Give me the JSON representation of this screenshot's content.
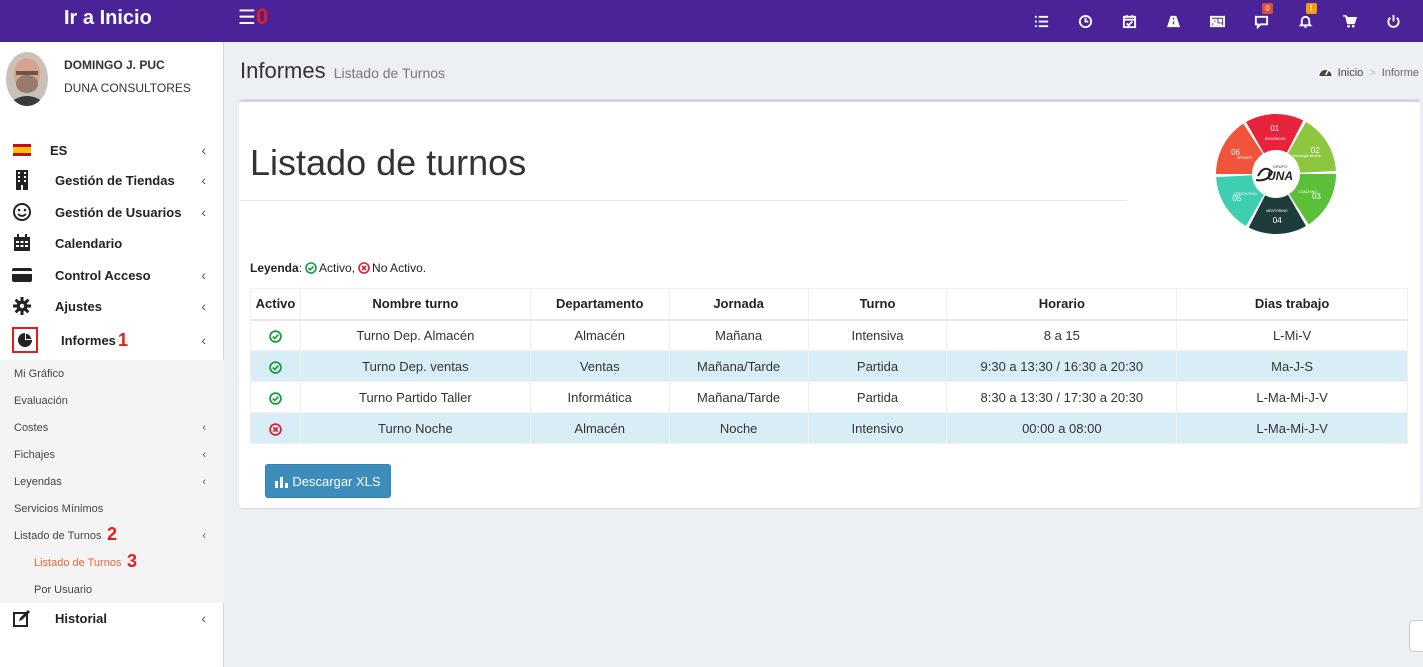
{
  "topbar": {
    "brand": "Ir a Inicio",
    "menu_count": "0",
    "badges": {
      "chat": "0",
      "notifications": "1"
    },
    "icons": [
      "list-icon",
      "clock-icon",
      "calendar-check-icon",
      "road-icon",
      "newspaper-icon",
      "chat-icon",
      "bell-icon",
      "cart-icon",
      "power-icon"
    ],
    "color": "#4a2398"
  },
  "user": {
    "name": "DOMINGO J. PUC",
    "company": "DUNA CONSULTORES"
  },
  "sidebar": {
    "items": [
      {
        "label": "ES"
      },
      {
        "label": "Gestión de Tiendas"
      },
      {
        "label": "Gestión de Usuarios"
      },
      {
        "label": "Calendario"
      },
      {
        "label": "Control Acceso"
      },
      {
        "label": "Ajustes"
      },
      {
        "label": "Informes",
        "marker": "1"
      },
      {
        "label": "Historial"
      }
    ],
    "subitems": [
      {
        "label": "Mi Gráfico"
      },
      {
        "label": "Evaluación"
      },
      {
        "label": "Costes"
      },
      {
        "label": "Fichajes"
      },
      {
        "label": "Leyendas"
      },
      {
        "label": "Servicios Mínimos"
      },
      {
        "label": "Listado de Turnos",
        "marker": "2"
      },
      {
        "label": "Listado de Turnos",
        "marker": "3"
      },
      {
        "label": "Por Usuario"
      }
    ]
  },
  "header": {
    "title": "Informes",
    "subtitle": "Listado de Turnos",
    "breadcrumb": {
      "home": "Inicio",
      "separator": ">",
      "current": "Informe"
    }
  },
  "main": {
    "title": "Listado de turnos",
    "legend": {
      "label": "Leyenda",
      "colon": ":",
      "active": "Activo,",
      "inactive": "No Activo."
    },
    "table": {
      "headers": [
        "Activo",
        "Nombre turno",
        "Departamento",
        "Jornada",
        "Turno",
        "Horario",
        "Dias trabajo"
      ],
      "rows": [
        {
          "active": true,
          "name": "Turno Dep. Almacén",
          "dept": "Almacén",
          "jornada": "Mañana",
          "turno": "Intensiva",
          "horario": "8 a 15",
          "dias": "L-Mi-V"
        },
        {
          "active": true,
          "name": "Turno Dep. ventas",
          "dept": "Ventas",
          "jornada": "Mañana/Tarde",
          "turno": "Partida",
          "horario": "9:30 a 13:30 / 16:30 a 20:30",
          "dias": "Ma-J-S"
        },
        {
          "active": true,
          "name": "Turno Partido Taller",
          "dept": "Informática",
          "jornada": "Mañana/Tarde",
          "turno": "Partida",
          "horario": "8:30 a 13:30 / 17:30 a 20:30",
          "dias": "L-Ma-Mi-J-V"
        },
        {
          "active": false,
          "name": "Turno Noche",
          "dept": "Almacén",
          "jornada": "Noche",
          "turno": "Intensivo",
          "horario": "00:00 a 08:00",
          "dias": "L-Ma-Mi-J-V"
        }
      ]
    },
    "download_button": "Descargar XLS",
    "logo": {
      "brand": "UNA",
      "group": "GRUPO",
      "segments": [
        {
          "num": "01",
          "label": "SEGURIDAD",
          "color": "#e8233c"
        },
        {
          "num": "02",
          "label": "tecnologia flexible",
          "color": "#8dc63f"
        },
        {
          "num": "03",
          "label": "COACHING",
          "color": "#5bbf3a"
        },
        {
          "num": "04",
          "label": "MENTORING",
          "color": "#1f3c3c"
        },
        {
          "num": "05",
          "label": "CREATIVIDAD",
          "color": "#3ecfb0"
        },
        {
          "num": "06",
          "label": "DRONES",
          "color": "#f0553b"
        }
      ]
    }
  },
  "colors": {
    "active": "#1a9c3a",
    "inactive": "#d9232e",
    "highlight": "#f0653b",
    "marker": "#e51c1c"
  }
}
